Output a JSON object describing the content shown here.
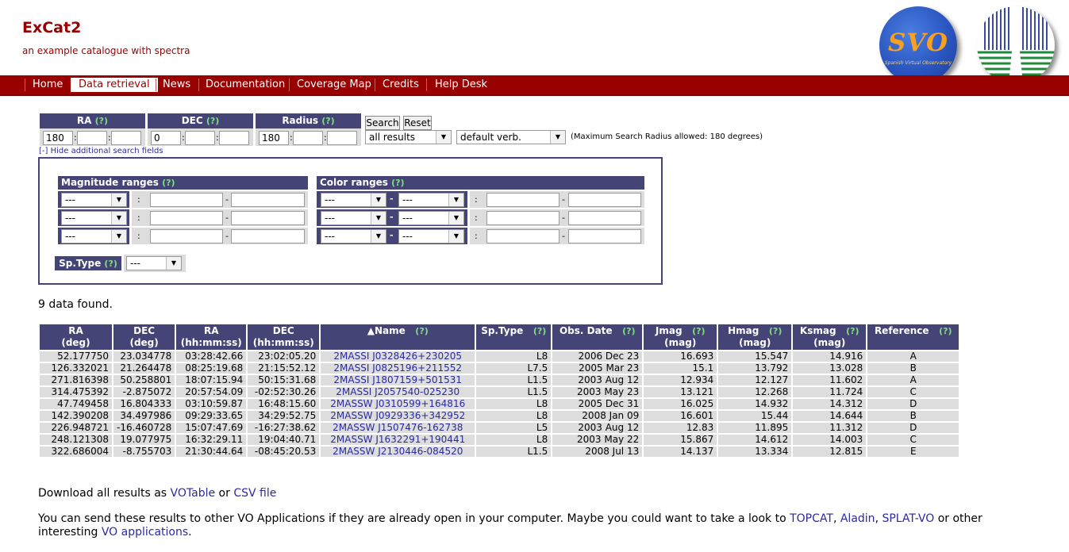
{
  "site": {
    "title": "ExCat2",
    "subtitle": "an example catalogue with spectra"
  },
  "nav": {
    "items": [
      "Home",
      "Data retrieval",
      "News",
      "Documentation",
      "Coverage Map",
      "Credits",
      "Help Desk"
    ],
    "active": "Data retrieval"
  },
  "logos": {
    "svo_text": "SVO",
    "svo_small": "Spanish Virtual Observatory"
  },
  "search": {
    "ra_label": "RA",
    "dec_label": "DEC",
    "radius_label": "Radius",
    "help": "(?)",
    "ra_value": "180",
    "dec_value": "0",
    "radius_value": "180",
    "search_button": "Search",
    "reset_button": "Reset",
    "results_select": "all results",
    "verb_select": "default verb.",
    "max_radius_note": "(Maximum Search Radius allowed: 180 degrees)",
    "hide_link": "[-] Hide additional search fields"
  },
  "filters": {
    "magnitude_label": "Magnitude ranges",
    "color_label": "Color ranges",
    "empty_select": "---",
    "sptype_label": "Sp.Type"
  },
  "results": {
    "count_text": "9 data found.",
    "headers": [
      {
        "l1": "RA",
        "l2": "(deg)"
      },
      {
        "l1": "DEC",
        "l2": "(deg)"
      },
      {
        "l1": "RA",
        "l2": "(hh:mm:ss)"
      },
      {
        "l1": "DEC",
        "l2": "(hh:mm:ss)"
      },
      {
        "l1": "▲Name",
        "l2": ""
      },
      {
        "l1": "Sp.Type",
        "l2": ""
      },
      {
        "l1": "Obs. Date",
        "l2": ""
      },
      {
        "l1": "Jmag",
        "l2": "(mag)"
      },
      {
        "l1": "Hmag",
        "l2": "(mag)"
      },
      {
        "l1": "Ksmag",
        "l2": "(mag)"
      },
      {
        "l1": "Reference",
        "l2": ""
      }
    ],
    "rows": [
      [
        "52.177750",
        "23.034778",
        "03:28:42.66",
        "23:02:05.20",
        "2MASSI J0328426+230205",
        "L8",
        "2006 Dec 23",
        "16.693",
        "15.547",
        "14.916",
        "A"
      ],
      [
        "126.332021",
        "21.264478",
        "08:25:19.68",
        "21:15:52.12",
        "2MASSI J0825196+211552",
        "L7.5",
        "2005 Mar 23",
        "15.1",
        "13.792",
        "13.028",
        "B"
      ],
      [
        "271.816398",
        "50.258801",
        "18:07:15.94",
        "50:15:31.68",
        "2MASSI J1807159+501531",
        "L1.5",
        "2003 Aug 12",
        "12.934",
        "12.127",
        "11.602",
        "A"
      ],
      [
        "314.475392",
        "-2.875072",
        "20:57:54.09",
        "-02:52:30.26",
        "2MASSI J2057540-025230",
        "L1.5",
        "2003 May 23",
        "13.121",
        "12.268",
        "11.724",
        "C"
      ],
      [
        "47.749458",
        "16.804333",
        "03:10:59.87",
        "16:48:15.60",
        "2MASSW J0310599+164816",
        "L8",
        "2005 Dec 31",
        "16.025",
        "14.932",
        "14.312",
        "D"
      ],
      [
        "142.390208",
        "34.497986",
        "09:29:33.65",
        "34:29:52.75",
        "2MASSW J0929336+342952",
        "L8",
        "2008 Jan 09",
        "16.601",
        "15.44",
        "14.644",
        "B"
      ],
      [
        "226.948721",
        "-16.460728",
        "15:07:47.69",
        "-16:27:38.62",
        "2MASSW J1507476-162738",
        "L5",
        "2003 Aug 12",
        "12.83",
        "11.895",
        "11.312",
        "D"
      ],
      [
        "248.121308",
        "19.077975",
        "16:32:29.11",
        "19:04:40.71",
        "2MASSW J1632291+190441",
        "L8",
        "2003 May 22",
        "15.867",
        "14.612",
        "14.003",
        "C"
      ],
      [
        "322.686004",
        "-8.755703",
        "21:30:44.64",
        "-08:45:20.53",
        "2MASSW J2130446-084520",
        "L1.5",
        "2008 Jul 13",
        "14.137",
        "13.334",
        "12.815",
        "E"
      ]
    ]
  },
  "download": {
    "prefix": "Download all results as ",
    "votable": "VOTable",
    "or": " or ",
    "csv": "CSV file"
  },
  "send": {
    "text1": "You can send these results to other VO Applications if they are already open in your computer. Maybe you could want to take a look to ",
    "topcat": "TOPCAT",
    "comma": ", ",
    "aladin": "Aladin",
    "splat": "SPLAT-VO",
    "text2": " or other",
    "text3": "interesting ",
    "vo_apps": "VO applications",
    "period": "."
  }
}
